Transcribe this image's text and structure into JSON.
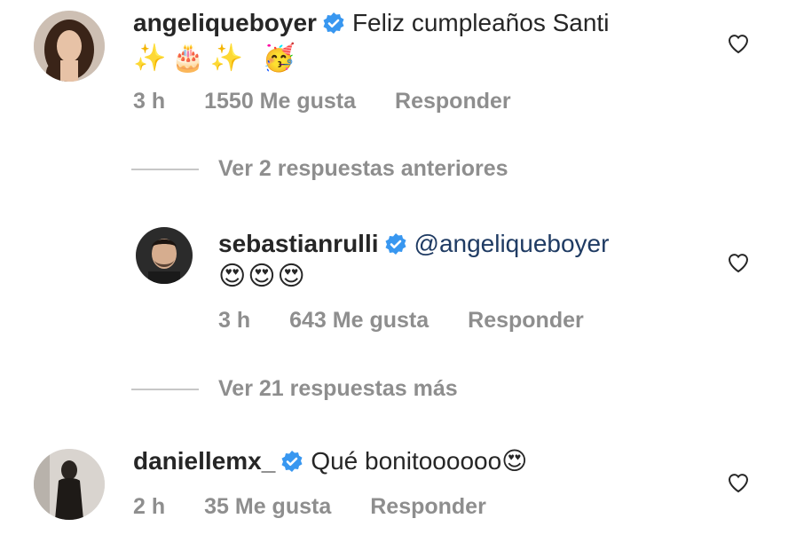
{
  "comments": [
    {
      "username": "angeliqueboyer",
      "text": "Feliz cumpleaños Santi",
      "emojis": "✨🎂✨ 🥳",
      "time": "3 h",
      "likes": "1550 Me gusta",
      "reply": "Responder",
      "avatar_icon": "user-avatar-woman"
    },
    {
      "username": "sebastianrulli",
      "mention": "@angeliqueboyer",
      "emojis": "😍😍😍",
      "time": "3 h",
      "likes": "643 Me gusta",
      "reply": "Responder",
      "avatar_icon": "user-avatar-man"
    },
    {
      "username": "daniellemx_",
      "text": "Qué bonitoooooo",
      "emoji_suffix": "😍",
      "time": "2 h",
      "likes": "35 Me gusta",
      "reply": "Responder",
      "avatar_icon": "user-avatar-woman-dark"
    }
  ],
  "thread": {
    "view_previous": "Ver 2 respuestas anteriores",
    "view_more": "Ver 21 respuestas más"
  },
  "colors": {
    "verified": "#3897f0",
    "meta": "#8e8e8e",
    "mention": "#1f3b63",
    "text": "#262626"
  }
}
